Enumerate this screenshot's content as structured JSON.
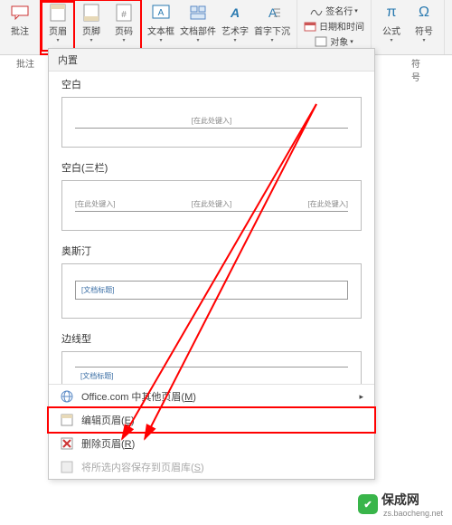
{
  "ribbon": {
    "col1": {
      "label": "批注"
    },
    "header_footer": {
      "header_label": "页眉",
      "footer_label": "页脚",
      "pagenum_label": "页码"
    },
    "text_group": {
      "textbox_label": "文本框",
      "parts_label": "文档部件",
      "wordart_label": "艺术字",
      "dropcap_label": "首字下沉"
    },
    "right_small": {
      "signature": "签名行",
      "datetime": "日期和时间",
      "object": "对象"
    },
    "symbols": {
      "equation_label": "公式",
      "symbol_label": "符号"
    },
    "secondary": {
      "col1": "批注",
      "group_label": "符号"
    }
  },
  "dropdown": {
    "section_head": "内置",
    "blank": {
      "title": "空白",
      "placeholder": "[在此处键入]"
    },
    "blank3": {
      "title": "空白(三栏)",
      "ph1": "[在此处键入]",
      "ph2": "[在此处键入]",
      "ph3": "[在此处键入]"
    },
    "austin": {
      "title": "奥斯汀",
      "placeholder": "[文档标题]"
    },
    "lined": {
      "title": "边线型",
      "placeholder": "[文档标题]"
    },
    "more_office": {
      "pre": "Office.com 中",
      "post": "其他页眉(",
      "key": "M",
      "suf": ")"
    },
    "edit": {
      "text": "编辑页眉(",
      "key": "E",
      "suf": ")"
    },
    "remove": {
      "text": "删除页眉(",
      "key": "R",
      "suf": ")"
    },
    "save": {
      "text": "将所选内容保存到页眉库(",
      "key": "S",
      "suf": ")"
    }
  },
  "watermark": {
    "brand": "保成网",
    "url": "zs.baocheng.net"
  }
}
